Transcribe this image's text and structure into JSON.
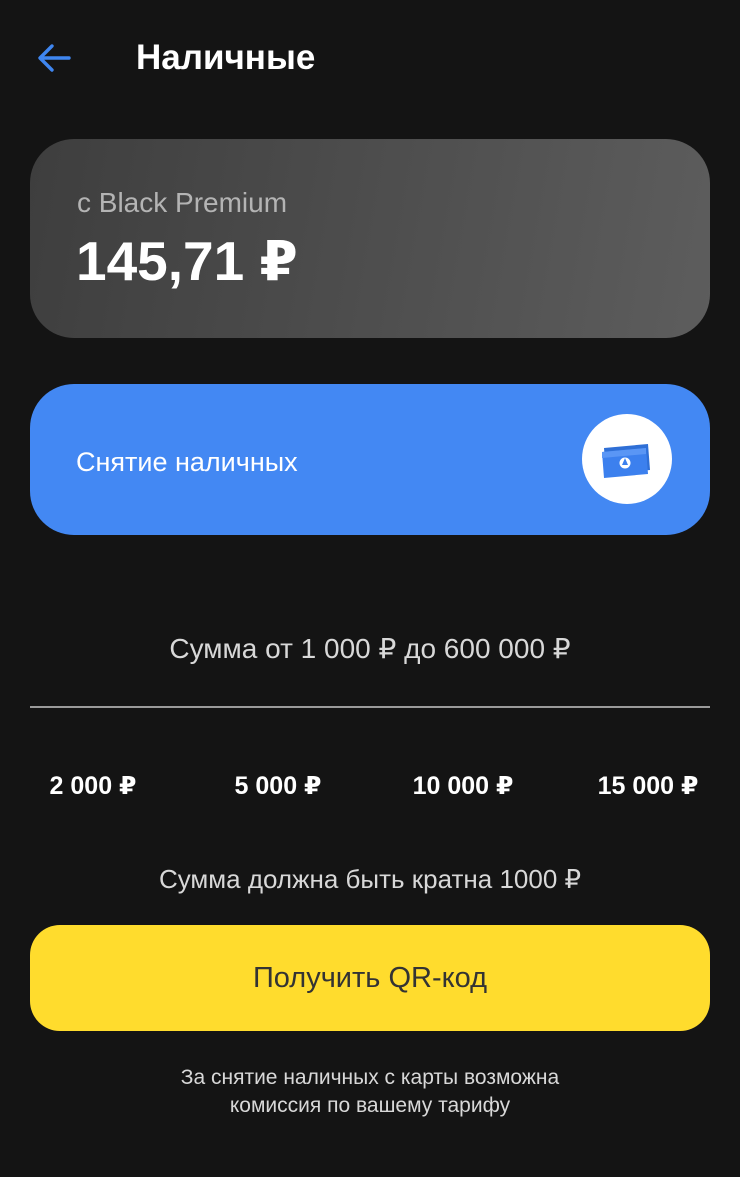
{
  "header": {
    "back_icon": "arrow-left-icon",
    "title": "Наличные"
  },
  "balance": {
    "label": "с Black Premium",
    "amount": "145,71 ₽"
  },
  "withdraw": {
    "label": "Снятие наличных",
    "icon": "cash-icon"
  },
  "amount_input": {
    "hint": "Сумма от 1 000 ₽ до 600 000 ₽",
    "value": ""
  },
  "quick_amounts": [
    "2 000 ₽",
    "5 000 ₽",
    "10 000 ₽",
    "15 000 ₽"
  ],
  "multiple_note": "Сумма должна быть кратна 1000 ₽",
  "qr_button": {
    "label": "Получить QR-код"
  },
  "commission_note": {
    "line1": "За снятие наличных с карты возможна",
    "line2": "комиссия по вашему тарифу"
  },
  "colors": {
    "background": "#141414",
    "accent_blue": "#4388f3",
    "accent_yellow": "#ffdc2d",
    "back_arrow": "#3f86f0"
  }
}
